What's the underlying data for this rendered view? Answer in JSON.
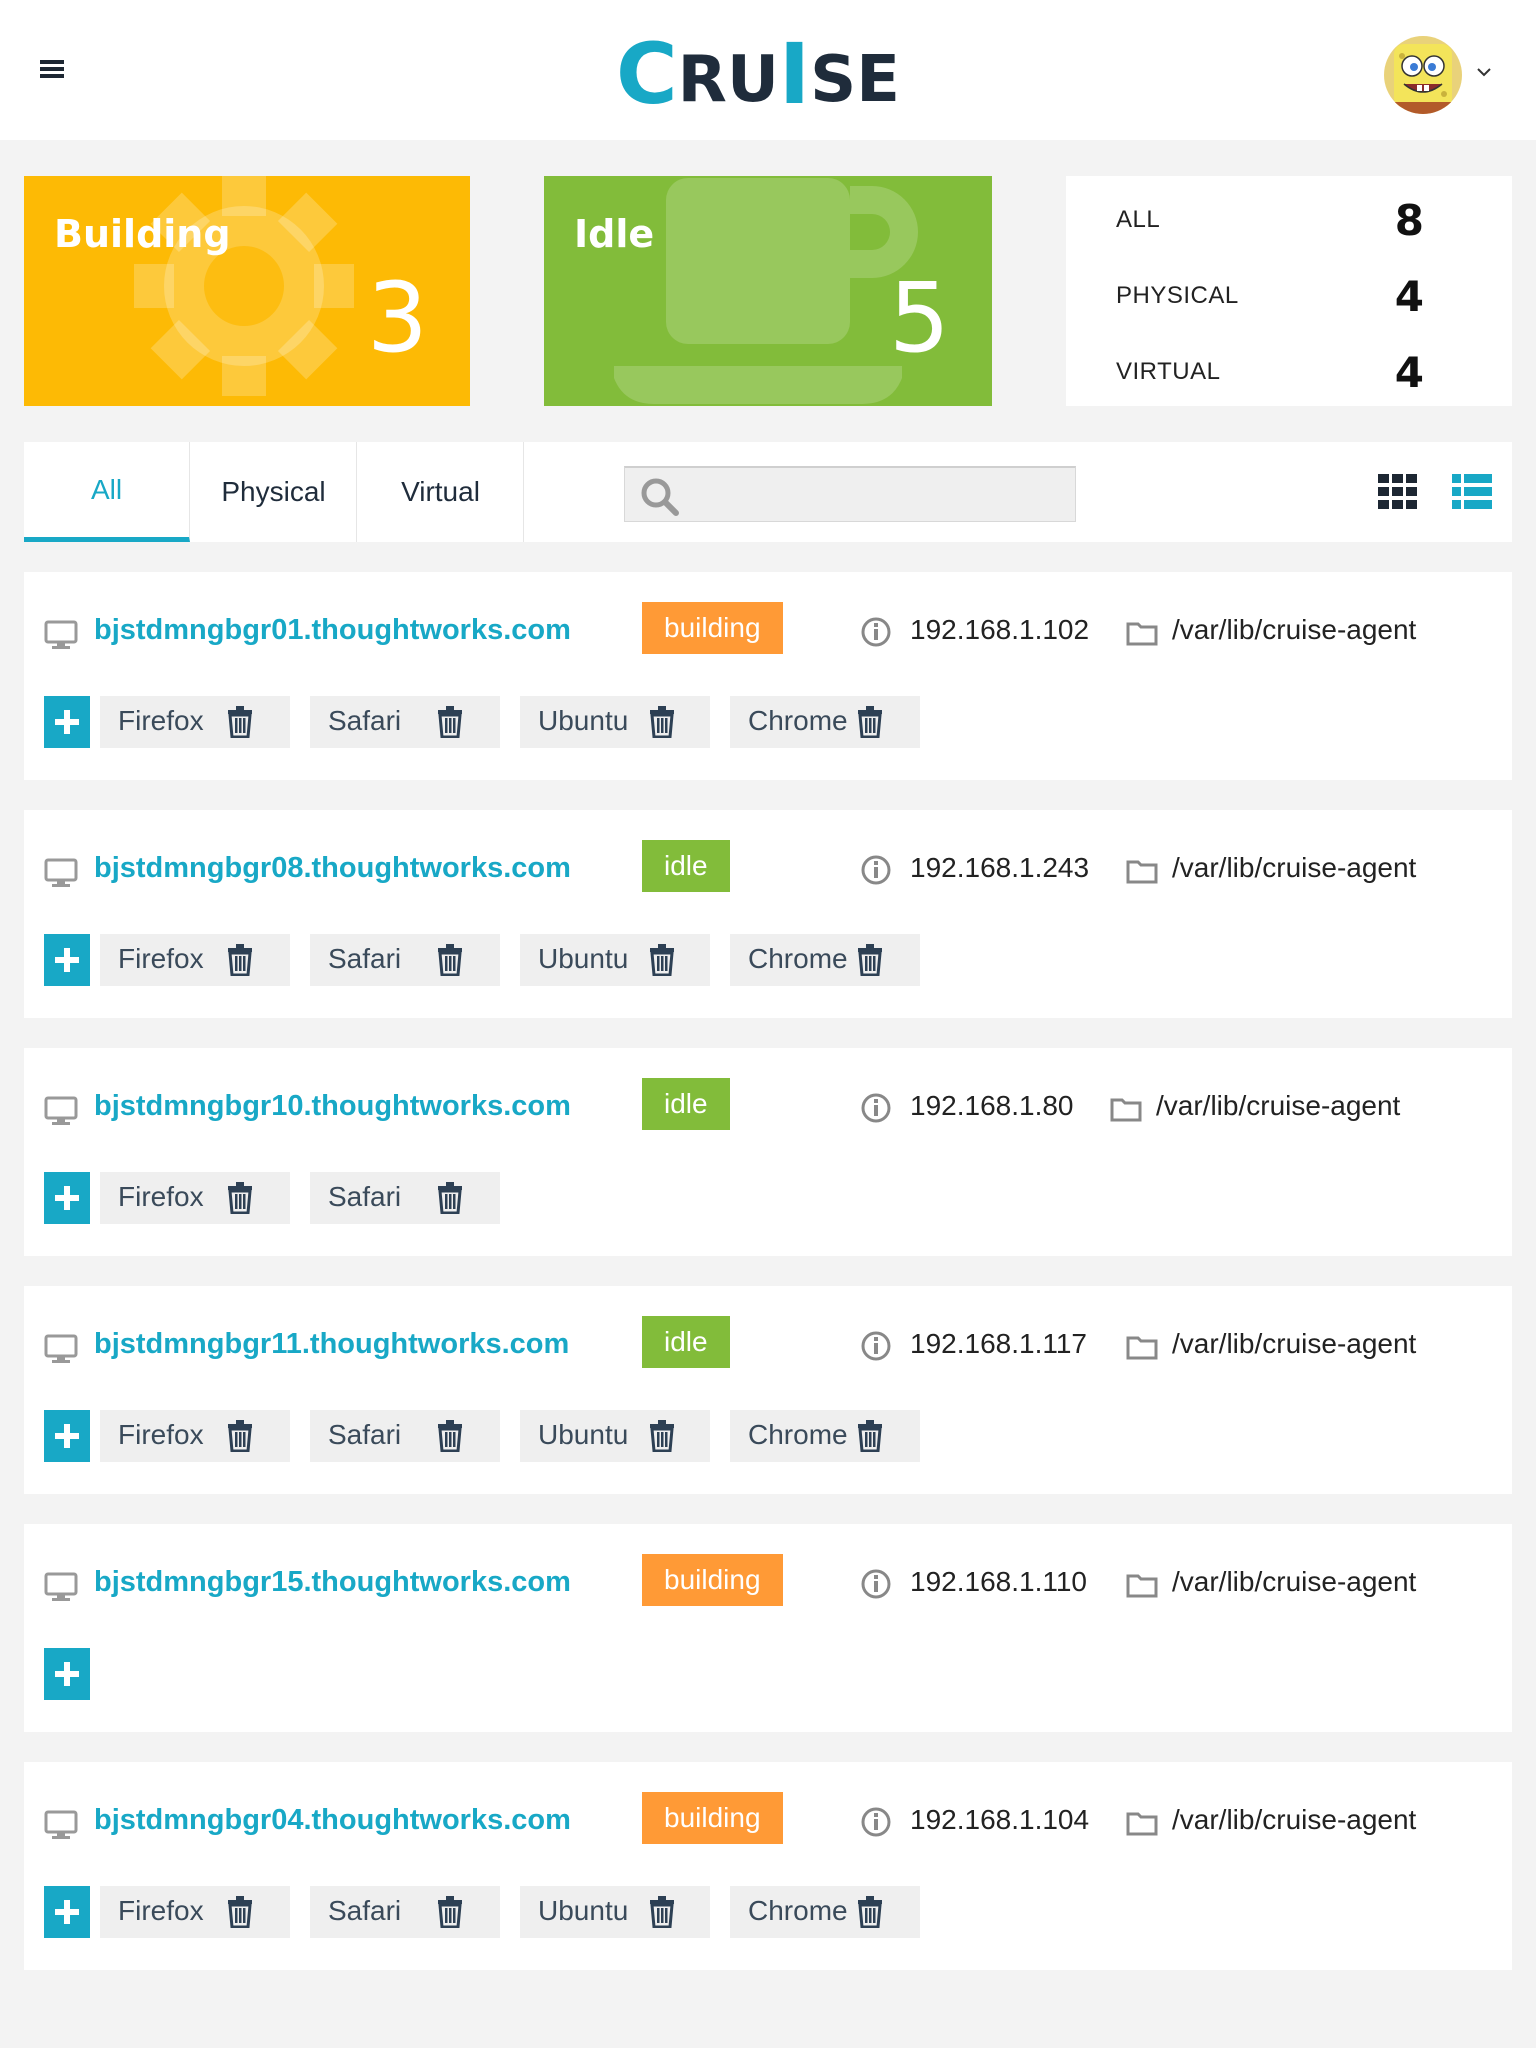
{
  "header": {
    "logo_first": "C",
    "logo_mid": "RU",
    "logo_i": "I",
    "logo_end": "SE"
  },
  "stats": {
    "building": {
      "label": "Building",
      "count": "3"
    },
    "idle": {
      "label": "Idle",
      "count": "5"
    },
    "summary": [
      {
        "key": "ALL",
        "value": "8"
      },
      {
        "key": "PHYSICAL",
        "value": "4"
      },
      {
        "key": "VIRTUAL",
        "value": "4"
      }
    ]
  },
  "tabs": [
    {
      "label": "All",
      "active": true
    },
    {
      "label": "Physical",
      "active": false
    },
    {
      "label": "Virtual",
      "active": false
    }
  ],
  "search": {
    "value": "",
    "placeholder": ""
  },
  "colors": {
    "accent": "#18a8c6",
    "building_tile": "#fdba05",
    "idle_tile": "#82bc3a",
    "status_building": "#ff9a36",
    "status_idle": "#82bc3a"
  },
  "agents": [
    {
      "hostname": "bjstdmngbgr01.thoughtworks.com",
      "status": "building",
      "ip": "192.168.1.102",
      "path": "/var/lib/cruise-agent",
      "resources": [
        "Firefox",
        "Safari",
        "Ubuntu",
        "Chrome"
      ]
    },
    {
      "hostname": "bjstdmngbgr08.thoughtworks.com",
      "status": "idle",
      "ip": "192.168.1.243",
      "path": "/var/lib/cruise-agent",
      "resources": [
        "Firefox",
        "Safari",
        "Ubuntu",
        "Chrome"
      ]
    },
    {
      "hostname": "bjstdmngbgr10.thoughtworks.com",
      "status": "idle",
      "ip": "192.168.1.80",
      "path": "/var/lib/cruise-agent",
      "resources": [
        "Firefox",
        "Safari"
      ]
    },
    {
      "hostname": "bjstdmngbgr11.thoughtworks.com",
      "status": "idle",
      "ip": "192.168.1.117",
      "path": "/var/lib/cruise-agent",
      "resources": [
        "Firefox",
        "Safari",
        "Ubuntu",
        "Chrome"
      ]
    },
    {
      "hostname": "bjstdmngbgr15.thoughtworks.com",
      "status": "building",
      "ip": "192.168.1.110",
      "path": "/var/lib/cruise-agent",
      "resources": []
    },
    {
      "hostname": "bjstdmngbgr04.thoughtworks.com",
      "status": "building",
      "ip": "192.168.1.104",
      "path": "/var/lib/cruise-agent",
      "resources": [
        "Firefox",
        "Safari",
        "Ubuntu",
        "Chrome"
      ]
    }
  ]
}
